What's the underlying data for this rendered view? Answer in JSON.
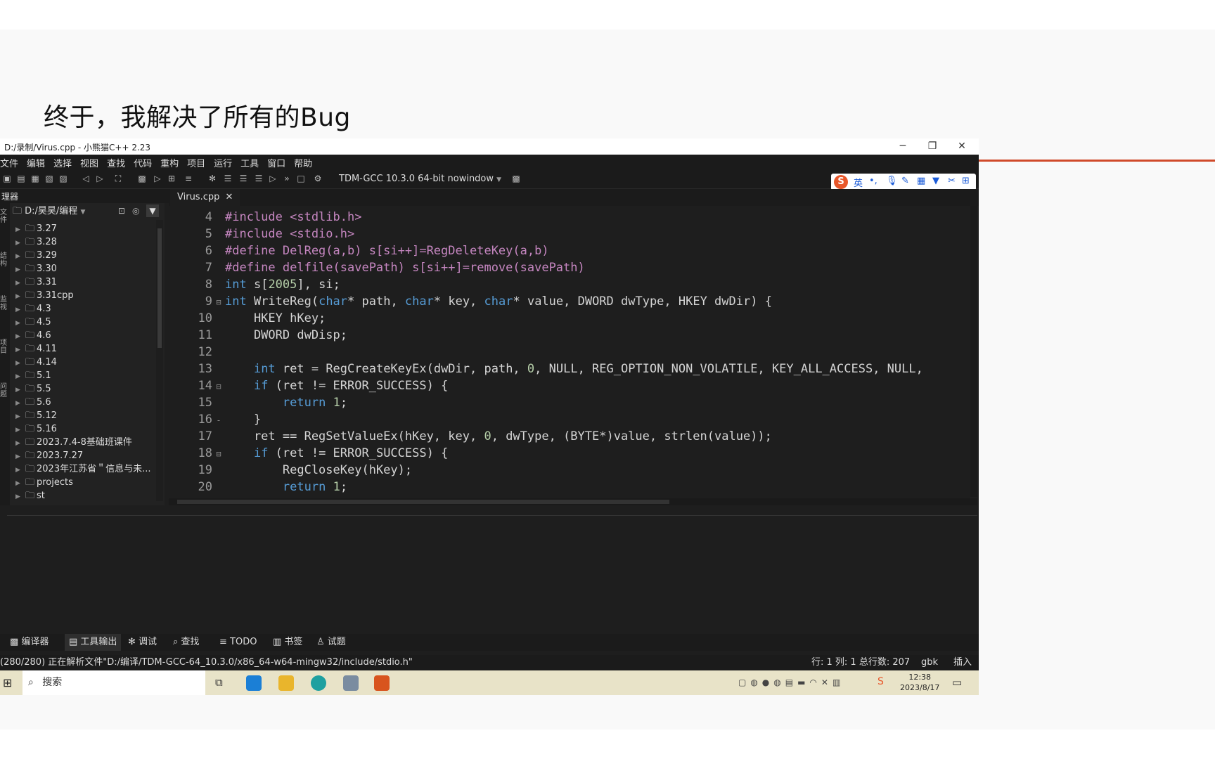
{
  "slide": {
    "title": "终于，我解决了所有的Bug"
  },
  "window": {
    "title": "D:/录制/Virus.cpp - 小熊猫C++ 2.23",
    "controls": {
      "minimize": "─",
      "restore": "❐",
      "close": "✕"
    },
    "menu": [
      "文件",
      "编辑",
      "选择",
      "视图",
      "查找",
      "代码",
      "重构",
      "项目",
      "运行",
      "工具",
      "窗口",
      "帮助"
    ],
    "compiler": "TDM-GCC 10.3.0 64-bit nowindow",
    "ime": {
      "lang": "英"
    }
  },
  "explorer": {
    "title": "理器",
    "path": "D:/昊昊/编程",
    "items": [
      "3.27",
      "3.28",
      "3.29",
      "3.30",
      "3.31",
      "3.31cpp",
      "4.3",
      "4.5",
      "4.6",
      "4.11",
      "4.14",
      "5.1",
      "5.5",
      "5.6",
      "5.12",
      "5.16",
      "2023.7.4-8基础班课件",
      "2023.7.27",
      "2023年江苏省＂信息与未...",
      "projects",
      "st"
    ]
  },
  "editor": {
    "tab": "Virus.cpp",
    "tab_close": "✕",
    "lines": [
      {
        "n": "4",
        "fold": "",
        "html": "<span class='pp'>#include &lt;stdlib.h&gt;</span>"
      },
      {
        "n": "5",
        "fold": "",
        "html": "<span class='pp'>#include &lt;stdio.h&gt;</span>"
      },
      {
        "n": "6",
        "fold": "",
        "html": "<span class='pp'>#define DelReg(a,b) s[si++]=RegDeleteKey(a,b)</span>"
      },
      {
        "n": "7",
        "fold": "",
        "html": "<span class='pp'>#define delfile(savePath) s[si++]=remove(savePath)</span>"
      },
      {
        "n": "8",
        "fold": "",
        "html": "<span class='kw'>int</span> s[<span class='num'>2005</span>], si;"
      },
      {
        "n": "9",
        "fold": "⊟",
        "html": "<span class='kw'>int</span> WriteReg(<span class='kw'>char</span>* path, <span class='kw'>char</span>* key, <span class='kw'>char</span>* value, DWORD dwType, HKEY dwDir) {"
      },
      {
        "n": "10",
        "fold": "",
        "html": "    HKEY hKey;"
      },
      {
        "n": "11",
        "fold": "",
        "html": "    DWORD dwDisp;"
      },
      {
        "n": "12",
        "fold": "",
        "html": ""
      },
      {
        "n": "13",
        "fold": "",
        "html": "    <span class='kw'>int</span> ret = RegCreateKeyEx(dwDir, path, <span class='num'>0</span>, NULL, REG_OPTION_NON_VOLATILE, KEY_ALL_ACCESS, NULL,"
      },
      {
        "n": "14",
        "fold": "⊟",
        "html": "    <span class='kw'>if</span> (ret != ERROR_SUCCESS) {"
      },
      {
        "n": "15",
        "fold": "",
        "html": "        <span class='kw'>return</span> <span class='num'>1</span>;"
      },
      {
        "n": "16",
        "fold": "-",
        "html": "    }"
      },
      {
        "n": "17",
        "fold": "",
        "html": "    ret == RegSetValueEx(hKey, key, <span class='num'>0</span>, dwType, (BYTE*)value, strlen(value));"
      },
      {
        "n": "18",
        "fold": "⊟",
        "html": "    <span class='kw'>if</span> (ret != ERROR_SUCCESS) {"
      },
      {
        "n": "19",
        "fold": "",
        "html": "        RegCloseKey(hKey);"
      },
      {
        "n": "20",
        "fold": "",
        "html": "        <span class='kw'>return</span> <span class='num'>1</span>;"
      }
    ]
  },
  "bottom_tabs": [
    "编译器",
    "工具输出",
    "调试",
    "查找",
    "TODO",
    "书签",
    "试题"
  ],
  "status": {
    "left": "(280/280)  正在解析文件\"D:/编译/TDM-GCC-64_10.3.0/x86_64-w64-mingw32/include/stdio.h\"",
    "pos": "行: 1 列: 1 总行数: 207",
    "encoding": "gbk",
    "mode": "插入"
  },
  "taskbar": {
    "search": "搜索",
    "time": "12:38",
    "date": "2023/8/17"
  },
  "colors": {
    "accent_rule": "#d04a2a",
    "editor_bg": "#1e1e1e"
  }
}
